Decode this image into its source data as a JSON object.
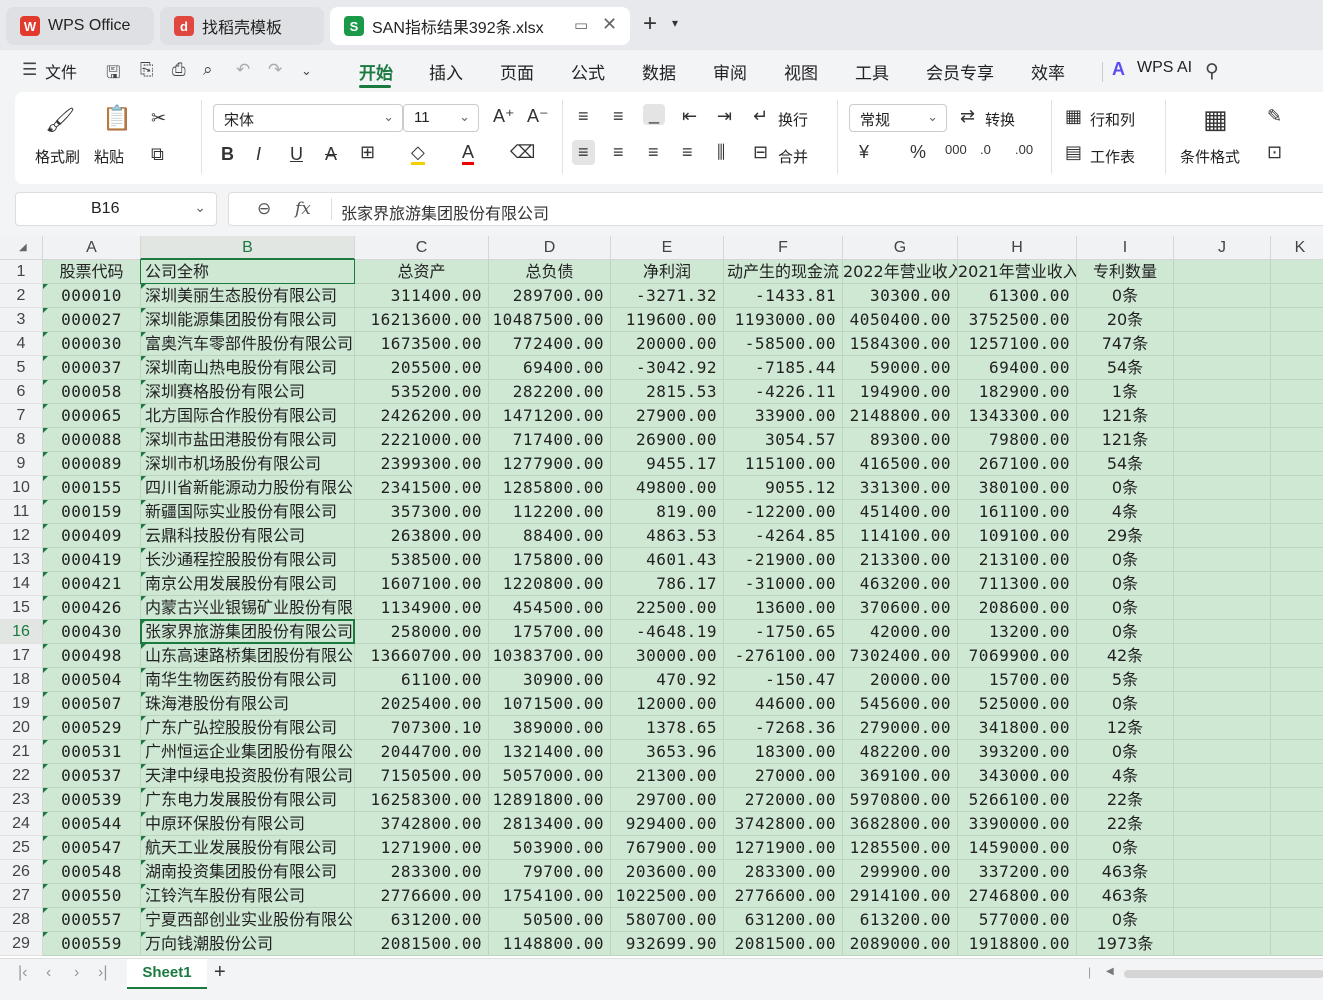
{
  "tabs": [
    {
      "label": "WPS Office",
      "icon": "wps-logo-icon"
    },
    {
      "label": "找稻壳模板",
      "icon": "docer-icon"
    },
    {
      "label": "SAN指标结果392条.xlsx",
      "icon": "spreadsheet-icon"
    }
  ],
  "menu": {
    "file": "文件",
    "items": [
      "开始",
      "插入",
      "页面",
      "公式",
      "数据",
      "审阅",
      "视图",
      "工具",
      "会员专享",
      "效率"
    ],
    "active": "开始",
    "ai": "WPS AI"
  },
  "ribbon": {
    "format_painter": "格式刷",
    "paste": "粘贴",
    "font": "宋体",
    "font_size": "11",
    "wrap": "换行",
    "merge": "合并",
    "number_format": "常规",
    "convert": "转换",
    "rows_cols": "行和列",
    "worksheet": "工作表",
    "cond_format": "条件格式"
  },
  "formula_bar": {
    "cell_ref": "B16",
    "fx": "fx",
    "content": "张家界旅游集团股份有限公司"
  },
  "columns": [
    "A",
    "B",
    "C",
    "D",
    "E",
    "F",
    "G",
    "H",
    "I",
    "J",
    "K"
  ],
  "header_row": [
    "股票代码",
    "公司全称",
    "总资产",
    "总负债",
    "净利润",
    "动产生的现金流",
    "2022年营业收入",
    "2021年营业收入",
    "专利数量"
  ],
  "rows": [
    [
      "000010",
      "深圳美丽生态股份有限公司",
      "311400.00",
      "289700.00",
      "-3271.32",
      "-1433.81",
      "30300.00",
      "61300.00",
      "0条"
    ],
    [
      "000027",
      "深圳能源集团股份有限公司",
      "16213600.00",
      "10487500.00",
      "119600.00",
      "1193000.00",
      "4050400.00",
      "3752500.00",
      "20条"
    ],
    [
      "000030",
      "富奥汽车零部件股份有限公司",
      "1673500.00",
      "772400.00",
      "20000.00",
      "-58500.00",
      "1584300.00",
      "1257100.00",
      "747条"
    ],
    [
      "000037",
      "深圳南山热电股份有限公司",
      "205500.00",
      "69400.00",
      "-3042.92",
      "-7185.44",
      "59000.00",
      "69400.00",
      "54条"
    ],
    [
      "000058",
      "深圳赛格股份有限公司",
      "535200.00",
      "282200.00",
      "2815.53",
      "-4226.11",
      "194900.00",
      "182900.00",
      "1条"
    ],
    [
      "000065",
      "北方国际合作股份有限公司",
      "2426200.00",
      "1471200.00",
      "27900.00",
      "33900.00",
      "2148800.00",
      "1343300.00",
      "121条"
    ],
    [
      "000088",
      "深圳市盐田港股份有限公司",
      "2221000.00",
      "717400.00",
      "26900.00",
      "3054.57",
      "89300.00",
      "79800.00",
      "121条"
    ],
    [
      "000089",
      "深圳市机场股份有限公司",
      "2399300.00",
      "1277900.00",
      "9455.17",
      "115100.00",
      "416500.00",
      "267100.00",
      "54条"
    ],
    [
      "000155",
      "四川省新能源动力股份有限公司",
      "2341500.00",
      "1285800.00",
      "49800.00",
      "9055.12",
      "331300.00",
      "380100.00",
      "0条"
    ],
    [
      "000159",
      "新疆国际实业股份有限公司",
      "357300.00",
      "112200.00",
      "819.00",
      "-12200.00",
      "451400.00",
      "161100.00",
      "4条"
    ],
    [
      "000409",
      "云鼎科技股份有限公司",
      "263800.00",
      "88400.00",
      "4863.53",
      "-4264.85",
      "114100.00",
      "109100.00",
      "29条"
    ],
    [
      "000419",
      "长沙通程控股股份有限公司",
      "538500.00",
      "175800.00",
      "4601.43",
      "-21900.00",
      "213300.00",
      "213100.00",
      "0条"
    ],
    [
      "000421",
      "南京公用发展股份有限公司",
      "1607100.00",
      "1220800.00",
      "786.17",
      "-31000.00",
      "463200.00",
      "711300.00",
      "0条"
    ],
    [
      "000426",
      "内蒙古兴业银锡矿业股份有限公司",
      "1134900.00",
      "454500.00",
      "22500.00",
      "13600.00",
      "370600.00",
      "208600.00",
      "0条"
    ],
    [
      "000430",
      "张家界旅游集团股份有限公司",
      "258000.00",
      "175700.00",
      "-4648.19",
      "-1750.65",
      "42000.00",
      "13200.00",
      "0条"
    ],
    [
      "000498",
      "山东高速路桥集团股份有限公司",
      "13660700.00",
      "10383700.00",
      "30000.00",
      "-276100.00",
      "7302400.00",
      "7069900.00",
      "42条"
    ],
    [
      "000504",
      "南华生物医药股份有限公司",
      "61100.00",
      "30900.00",
      "470.92",
      "-150.47",
      "20000.00",
      "15700.00",
      "5条"
    ],
    [
      "000507",
      "珠海港股份有限公司",
      "2025400.00",
      "1071500.00",
      "12000.00",
      "44600.00",
      "545600.00",
      "525000.00",
      "0条"
    ],
    [
      "000529",
      "广东广弘控股股份有限公司",
      "707300.10",
      "389000.00",
      "1378.65",
      "-7268.36",
      "279000.00",
      "341800.00",
      "12条"
    ],
    [
      "000531",
      "广州恒运企业集团股份有限公司",
      "2044700.00",
      "1321400.00",
      "3653.96",
      "18300.00",
      "482200.00",
      "393200.00",
      "0条"
    ],
    [
      "000537",
      "天津中绿电投资股份有限公司",
      "7150500.00",
      "5057000.00",
      "21300.00",
      "27000.00",
      "369100.00",
      "343000.00",
      "4条"
    ],
    [
      "000539",
      "广东电力发展股份有限公司",
      "16258300.00",
      "12891800.00",
      "29700.00",
      "272000.00",
      "5970800.00",
      "5266100.00",
      "22条"
    ],
    [
      "000544",
      "中原环保股份有限公司",
      "3742800.00",
      "2813400.00",
      "929400.00",
      "3742800.00",
      "3682800.00",
      "3390000.00",
      "22条"
    ],
    [
      "000547",
      "航天工业发展股份有限公司",
      "1271900.00",
      "503900.00",
      "767900.00",
      "1271900.00",
      "1285500.00",
      "1459000.00",
      "0条"
    ],
    [
      "000548",
      "湖南投资集团股份有限公司",
      "283300.00",
      "79700.00",
      "203600.00",
      "283300.00",
      "299900.00",
      "337200.00",
      "463条"
    ],
    [
      "000550",
      "江铃汽车股份有限公司",
      "2776600.00",
      "1754100.00",
      "1022500.00",
      "2776600.00",
      "2914100.00",
      "2746800.00",
      "463条"
    ],
    [
      "000557",
      "宁夏西部创业实业股份有限公司",
      "631200.00",
      "50500.00",
      "580700.00",
      "631200.00",
      "613200.00",
      "577000.00",
      "0条"
    ],
    [
      "000559",
      "万向钱潮股份公司",
      "2081500.00",
      "1148800.00",
      "932699.90",
      "2081500.00",
      "2089000.00",
      "1918800.00",
      "1973条"
    ]
  ],
  "sheet_tab": "Sheet1",
  "selected_row": 16,
  "colors": {
    "accent": "#1a7a40",
    "cell_fill": "#cfe8d3"
  }
}
